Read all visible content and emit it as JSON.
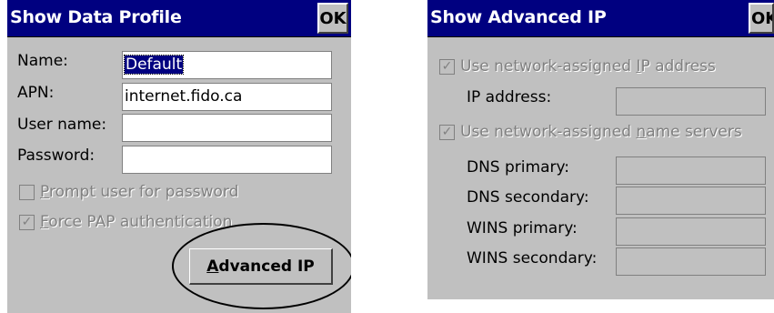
{
  "data_profile": {
    "title": "Show Data Profile",
    "ok_label": "OK",
    "name_label": "Name:",
    "name_value": "Default",
    "apn_label": "APN:",
    "apn_value": "internet.fido.ca",
    "user_name_label": "User name:",
    "user_name_value": "",
    "password_label": "Password:",
    "password_value": "",
    "prompt_label_first": "P",
    "prompt_label_rest": "rompt user for password",
    "prompt_checked": false,
    "pap_label_first": "F",
    "pap_label_rest": "orce PAP authentication",
    "pap_checked": true,
    "advanced_label_first": "A",
    "advanced_label_rest": "dvanced IP"
  },
  "advanced_ip": {
    "title": "Show Advanced IP",
    "ok_label": "OK",
    "use_ip_label_before": "Use network-assigned ",
    "use_ip_label_ul": "I",
    "use_ip_label_after": "P address",
    "use_ip_checked": true,
    "ip_address_label": "IP address:",
    "ip_address_value": "",
    "use_ns_label_before": "Use network-assigned ",
    "use_ns_label_ul": "n",
    "use_ns_label_after": "ame servers",
    "use_ns_checked": true,
    "dns_primary_label": "DNS primary:",
    "dns_secondary_label": "DNS secondary:",
    "wins_primary_label": "WINS primary:",
    "wins_secondary_label": "WINS secondary:",
    "dns_primary_value": "",
    "dns_secondary_value": "",
    "wins_primary_value": "",
    "wins_secondary_value": ""
  },
  "icons": {
    "checkmark": "check-icon"
  }
}
